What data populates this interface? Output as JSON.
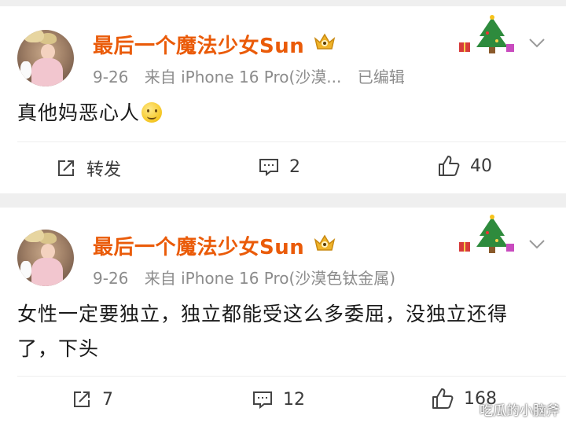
{
  "posts": [
    {
      "username": "最后一个魔法少女Sun",
      "date": "9-26",
      "source": "来自 iPhone 16 Pro(沙漠...",
      "edited": "已编辑",
      "content": "真他妈恶心人",
      "has_emoji": true,
      "emoji_icon": "smile-emoji-icon",
      "repost_label": "转发",
      "comment_count": "2",
      "like_count": "40"
    },
    {
      "username": "最后一个魔法少女Sun",
      "date": "9-26",
      "source": "来自 iPhone 16 Pro(沙漠色钛金属)",
      "edited": "",
      "content": "女性一定要独立，独立都能受这么多委屈，没独立还得了，下头",
      "has_emoji": false,
      "repost_label": "7",
      "comment_count": "12",
      "like_count": "168"
    }
  ],
  "icons": {
    "repost": "share-square-icon",
    "comment": "comment-bubble-icon",
    "like": "thumbs-up-icon",
    "badge": "gold-crown-badge-icon",
    "decoration": "christmas-tree-decoration-icon",
    "menu": "chevron-down-icon"
  },
  "colors": {
    "username": "#ea5b09",
    "meta": "#8c8c8c",
    "background": "#efefef"
  },
  "watermark": "吃瓜的小脑斧"
}
